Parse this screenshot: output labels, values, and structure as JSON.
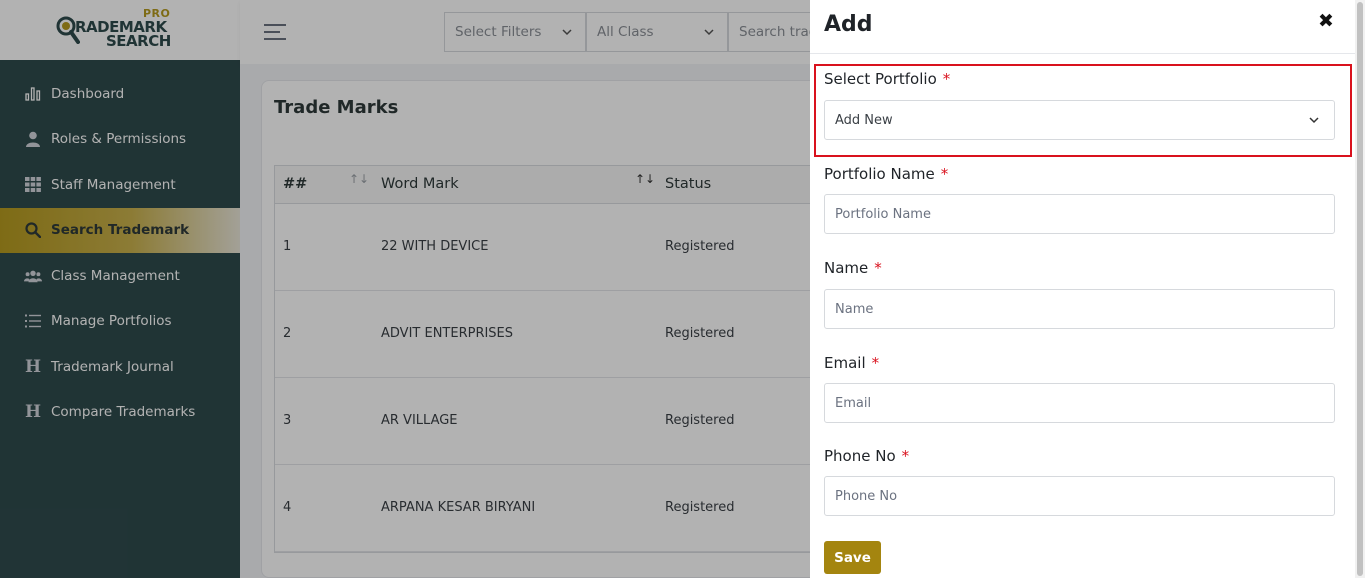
{
  "brand": {
    "pro": "PRO",
    "line1": "RADEMARK",
    "line2": "SEARCH"
  },
  "sidebar": {
    "items": [
      {
        "label": "Dashboard",
        "icon": "bar-chart-icon"
      },
      {
        "label": "Roles & Permissions",
        "icon": "user-icon"
      },
      {
        "label": "Staff Management",
        "icon": "grid-icon"
      },
      {
        "label": "Search Trademark",
        "icon": "search-icon",
        "active": true
      },
      {
        "label": "Class Management",
        "icon": "users-icon"
      },
      {
        "label": "Manage Portfolios",
        "icon": "list-icon"
      },
      {
        "label": "Trademark Journal",
        "icon": "h-icon"
      },
      {
        "label": "Compare Trademarks",
        "icon": "h-icon"
      }
    ]
  },
  "topbar": {
    "filters": {
      "select_filters": "Select Filters",
      "class": "All Class",
      "search_placeholder": "Search trad"
    }
  },
  "main": {
    "card_title": "Trade Marks",
    "table": {
      "headers": {
        "num": "##",
        "word_mark": "Word Mark",
        "status": "Status"
      },
      "rows": [
        {
          "num": "1",
          "word_mark": "22 WITH DEVICE",
          "status": "Registered"
        },
        {
          "num": "2",
          "word_mark": "ADVIT ENTERPRISES",
          "status": "Registered"
        },
        {
          "num": "3",
          "word_mark": "AR VILLAGE",
          "status": "Registered"
        },
        {
          "num": "4",
          "word_mark": "ARPANA KESAR BIRYANI",
          "status": "Registered"
        }
      ]
    }
  },
  "drawer": {
    "title": "Add",
    "close_symbol": "✖",
    "required_mark": "*",
    "fields": {
      "portfolio": {
        "label": "Select Portfolio",
        "value": "Add New"
      },
      "portfolio_name": {
        "label": "Portfolio Name",
        "placeholder": "Portfolio Name"
      },
      "name": {
        "label": "Name",
        "placeholder": "Name"
      },
      "email": {
        "label": "Email",
        "placeholder": "Email"
      },
      "phone": {
        "label": "Phone No",
        "placeholder": "Phone No"
      }
    },
    "save_label": "Save"
  },
  "colors": {
    "sidebar_bg": "#2f4b4d",
    "accent_gold": "#a4850f",
    "required_red": "#d9111d",
    "highlight_border": "#d9111d"
  }
}
